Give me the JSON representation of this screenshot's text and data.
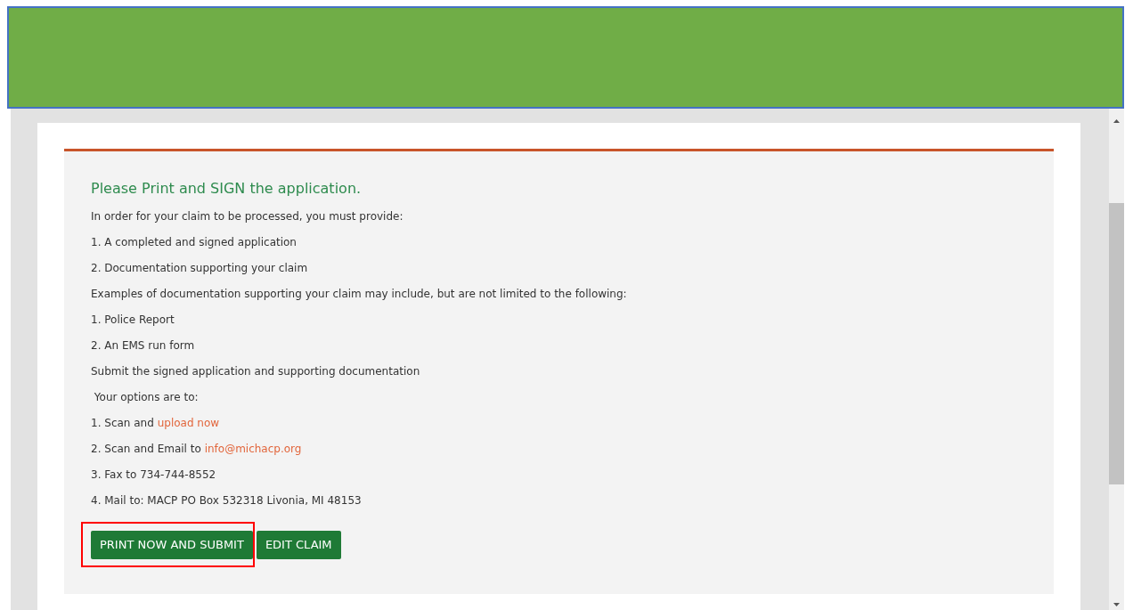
{
  "heading": "Please Print and SIGN the application.",
  "lines": [
    {
      "text": "In order for your claim to be processed, you must provide:"
    },
    {
      "text": "1. A completed and signed application"
    },
    {
      "text": "2. Documentation supporting your claim"
    },
    {
      "text": "Examples of documentation supporting your claim may include, but are not limited to the following:"
    },
    {
      "text": "1. Police Report"
    },
    {
      "text": "2. An EMS run form"
    },
    {
      "text": "Submit the signed application and supporting documentation"
    },
    {
      "text": " Your options are to:"
    },
    {
      "text": "1. Scan and ",
      "link": "upload now"
    },
    {
      "text": "2. Scan and Email to ",
      "link": "info@michacp.org"
    },
    {
      "text": "3. Fax to 734-744-8552"
    },
    {
      "text": "4. Mail to: MACP PO Box 532318 Livonia, MI 48153"
    }
  ],
  "buttons": [
    {
      "label": "PRINT NOW AND SUBMIT",
      "highlighted": true
    },
    {
      "label": "EDIT CLAIM",
      "highlighted": false
    }
  ]
}
